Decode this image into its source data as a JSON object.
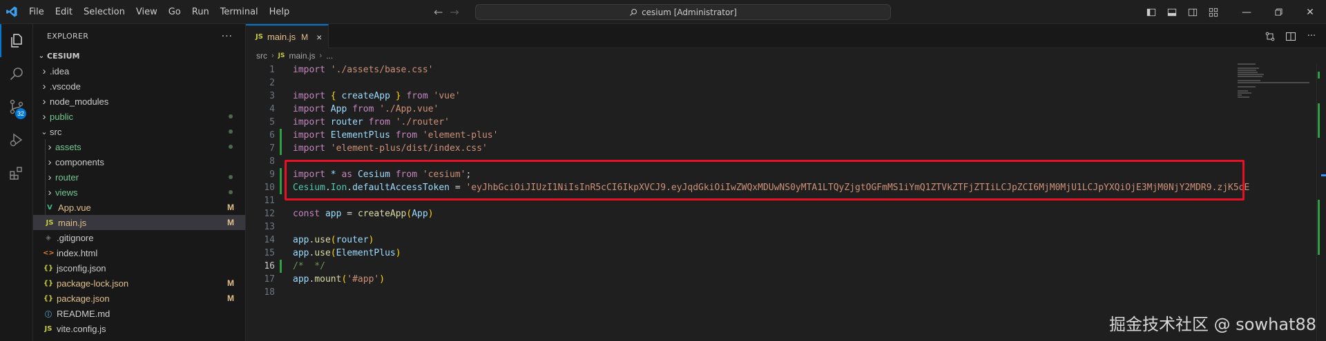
{
  "titlebar": {
    "menu": [
      "File",
      "Edit",
      "Selection",
      "View",
      "Go",
      "Run",
      "Terminal",
      "Help"
    ],
    "command_center": "cesium [Administrator]"
  },
  "activity": {
    "scm_badge": "32"
  },
  "explorer": {
    "title": "EXPLORER",
    "more": "···",
    "section": "CESIUM",
    "items": [
      {
        "label": ".idea",
        "type": "folder",
        "open": false,
        "depth": 1,
        "color": "#cccccc",
        "status": ""
      },
      {
        "label": ".vscode",
        "type": "folder",
        "open": false,
        "depth": 1,
        "color": "#cccccc",
        "status": ""
      },
      {
        "label": "node_modules",
        "type": "folder",
        "open": false,
        "depth": 1,
        "color": "#cccccc",
        "status": ""
      },
      {
        "label": "public",
        "type": "folder",
        "open": false,
        "depth": 1,
        "color": "#73c991",
        "status": "dot"
      },
      {
        "label": "src",
        "type": "folder",
        "open": true,
        "depth": 1,
        "color": "#cccccc",
        "status": "dot"
      },
      {
        "label": "assets",
        "type": "folder",
        "open": false,
        "depth": 2,
        "color": "#73c991",
        "status": "dot"
      },
      {
        "label": "components",
        "type": "folder",
        "open": false,
        "depth": 2,
        "color": "#cccccc",
        "status": ""
      },
      {
        "label": "router",
        "type": "folder",
        "open": false,
        "depth": 2,
        "color": "#73c991",
        "status": "dot"
      },
      {
        "label": "views",
        "type": "folder",
        "open": false,
        "depth": 2,
        "color": "#73c991",
        "status": "dot"
      },
      {
        "label": "App.vue",
        "type": "vue",
        "depth": 2,
        "color": "#e2c08d",
        "status": "M"
      },
      {
        "label": "main.js",
        "type": "js",
        "depth": 2,
        "color": "#e2c08d",
        "status": "M",
        "selected": true
      },
      {
        "label": ".gitignore",
        "type": "git",
        "depth": 1,
        "color": "#cccccc",
        "status": ""
      },
      {
        "label": "index.html",
        "type": "html",
        "depth": 1,
        "color": "#cccccc",
        "status": ""
      },
      {
        "label": "jsconfig.json",
        "type": "json",
        "depth": 1,
        "color": "#cccccc",
        "status": ""
      },
      {
        "label": "package-lock.json",
        "type": "json",
        "depth": 1,
        "color": "#e2c08d",
        "status": "M"
      },
      {
        "label": "package.json",
        "type": "json",
        "depth": 1,
        "color": "#e2c08d",
        "status": "M"
      },
      {
        "label": "README.md",
        "type": "info",
        "depth": 1,
        "color": "#cccccc",
        "status": ""
      },
      {
        "label": "vite.config.js",
        "type": "js",
        "depth": 1,
        "color": "#cccccc",
        "status": ""
      }
    ]
  },
  "editor": {
    "tab": {
      "label": "main.js",
      "modified": "M",
      "close": "×"
    },
    "breadcrumb": [
      "src",
      "main.js",
      "..."
    ],
    "current_line": 16,
    "modified_lines": [
      6,
      7,
      9,
      10,
      16
    ],
    "lines": [
      [
        [
          "kw",
          "import"
        ],
        [
          "t",
          " "
        ],
        [
          "str",
          "'./assets/base.css'"
        ]
      ],
      [],
      [
        [
          "kw",
          "import"
        ],
        [
          "t",
          " "
        ],
        [
          "br",
          "{"
        ],
        [
          "t",
          " "
        ],
        [
          "var",
          "createApp"
        ],
        [
          "t",
          " "
        ],
        [
          "br",
          "}"
        ],
        [
          "t",
          " "
        ],
        [
          "kw",
          "from"
        ],
        [
          "t",
          " "
        ],
        [
          "str",
          "'vue'"
        ]
      ],
      [
        [
          "kw",
          "import"
        ],
        [
          "t",
          " "
        ],
        [
          "var",
          "App"
        ],
        [
          "t",
          " "
        ],
        [
          "kw",
          "from"
        ],
        [
          "t",
          " "
        ],
        [
          "str",
          "'./App.vue'"
        ]
      ],
      [
        [
          "kw",
          "import"
        ],
        [
          "t",
          " "
        ],
        [
          "var",
          "router"
        ],
        [
          "t",
          " "
        ],
        [
          "kw",
          "from"
        ],
        [
          "t",
          " "
        ],
        [
          "str",
          "'./router'"
        ]
      ],
      [
        [
          "kw",
          "import"
        ],
        [
          "t",
          " "
        ],
        [
          "var",
          "ElementPlus"
        ],
        [
          "t",
          " "
        ],
        [
          "kw",
          "from"
        ],
        [
          "t",
          " "
        ],
        [
          "str",
          "'element-plus'"
        ]
      ],
      [
        [
          "kw",
          "import"
        ],
        [
          "t",
          " "
        ],
        [
          "str",
          "'element-plus/dist/index.css'"
        ]
      ],
      [],
      [
        [
          "kw",
          "import"
        ],
        [
          "t",
          " "
        ],
        [
          "var",
          "*"
        ],
        [
          "t",
          " "
        ],
        [
          "kw",
          "as"
        ],
        [
          "t",
          " "
        ],
        [
          "var",
          "Cesium"
        ],
        [
          "t",
          " "
        ],
        [
          "kw",
          "from"
        ],
        [
          "t",
          " "
        ],
        [
          "str",
          "'cesium'"
        ],
        [
          "t",
          ";"
        ]
      ],
      [
        [
          "cls",
          "Cesium"
        ],
        [
          "t",
          "."
        ],
        [
          "cls",
          "Ion"
        ],
        [
          "t",
          "."
        ],
        [
          "var",
          "defaultAccessToken"
        ],
        [
          "t",
          " = "
        ],
        [
          "str",
          "'eyJhbGciOiJIUzI1NiIsInR5cCI6IkpXVCJ9.eyJqdGkiOiIwZWQxMDUwNS0yMTA1LTQyZjgtOGFmMS1iYmQ1ZTVkZTFjZTIiLCJpZCI6MjM0MjU1LCJpYXQiOjE3MjM0NjY2MDR9.zjK5oE"
        ]
      ],
      [],
      [
        [
          "kw",
          "const"
        ],
        [
          "t",
          " "
        ],
        [
          "var",
          "app"
        ],
        [
          "t",
          " = "
        ],
        [
          "fn",
          "createApp"
        ],
        [
          "br",
          "("
        ],
        [
          "var",
          "App"
        ],
        [
          "br",
          ")"
        ]
      ],
      [],
      [
        [
          "var",
          "app"
        ],
        [
          "t",
          "."
        ],
        [
          "fn",
          "use"
        ],
        [
          "br",
          "("
        ],
        [
          "var",
          "router"
        ],
        [
          "br",
          ")"
        ]
      ],
      [
        [
          "var",
          "app"
        ],
        [
          "t",
          "."
        ],
        [
          "fn",
          "use"
        ],
        [
          "br",
          "("
        ],
        [
          "var",
          "ElementPlus"
        ],
        [
          "br",
          ")"
        ]
      ],
      [
        [
          "com",
          "/*  */"
        ]
      ],
      [
        [
          "var",
          "app"
        ],
        [
          "t",
          "."
        ],
        [
          "fn",
          "mount"
        ],
        [
          "br",
          "("
        ],
        [
          "str",
          "'#app'"
        ],
        [
          "br",
          ")"
        ]
      ],
      []
    ]
  },
  "watermark": "掘金技术社区 @ sowhat88",
  "colors": {
    "accent": "#0078d4",
    "modified": "#e2c08d",
    "untracked": "#73c991",
    "highlight_box": "#e81123"
  }
}
